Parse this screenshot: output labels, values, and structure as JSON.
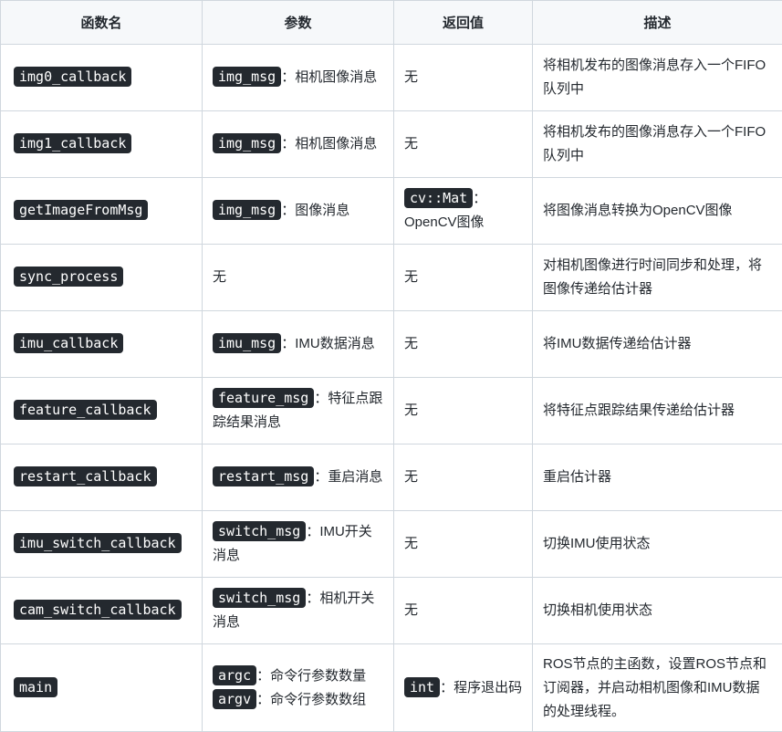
{
  "headers": [
    "函数名",
    "参数",
    "返回值",
    "描述"
  ],
  "rows": [
    {
      "name": "img0_callback",
      "param_code": "img_msg",
      "param_text": "：相机图像消息",
      "ret_code": "",
      "ret_text": "无",
      "desc": "将相机发布的图像消息存入一个FIFO队列中"
    },
    {
      "name": "img1_callback",
      "param_code": "img_msg",
      "param_text": "：相机图像消息",
      "ret_code": "",
      "ret_text": "无",
      "desc": "将相机发布的图像消息存入一个FIFO队列中"
    },
    {
      "name": "getImageFromMsg",
      "param_code": "img_msg",
      "param_text": "：图像消息",
      "ret_code": "cv::Mat",
      "ret_text": "：OpenCV图像",
      "desc": "将图像消息转换为OpenCV图像"
    },
    {
      "name": "sync_process",
      "param_code": "",
      "param_text": "无",
      "ret_code": "",
      "ret_text": "无",
      "desc": "对相机图像进行时间同步和处理，将图像传递给估计器"
    },
    {
      "name": "imu_callback",
      "param_code": "imu_msg",
      "param_text": "：IMU数据消息",
      "ret_code": "",
      "ret_text": "无",
      "desc": "将IMU数据传递给估计器"
    },
    {
      "name": "feature_callback",
      "param_code": "feature_msg",
      "param_text": "：特征点跟踪结果消息",
      "ret_code": "",
      "ret_text": "无",
      "desc": "将特征点跟踪结果传递给估计器"
    },
    {
      "name": "restart_callback",
      "param_code": "restart_msg",
      "param_text": "：重启消息",
      "ret_code": "",
      "ret_text": "无",
      "desc": "重启估计器"
    },
    {
      "name": "imu_switch_callback",
      "param_code": "switch_msg",
      "param_text": "：IMU开关消息",
      "ret_code": "",
      "ret_text": "无",
      "desc": "切换IMU使用状态"
    },
    {
      "name": "cam_switch_callback",
      "param_code": "switch_msg",
      "param_text": "：相机开关消息",
      "ret_code": "",
      "ret_text": "无",
      "desc": "切换相机使用状态"
    }
  ],
  "main_row": {
    "name": "main",
    "params": [
      {
        "code": "argc",
        "text": "：命令行参数数量"
      },
      {
        "code": "argv",
        "text": "：命令行参数数组"
      }
    ],
    "ret_code": "int",
    "ret_text": "：程序退出码",
    "desc": "ROS节点的主函数，设置ROS节点和订阅器，并启动相机图像和IMU数据的处理线程。"
  }
}
